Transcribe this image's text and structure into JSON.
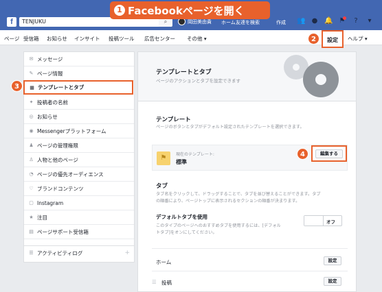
{
  "callout": {
    "number": "1",
    "text": "Facebookページを開く"
  },
  "topbar": {
    "logo": "f",
    "search_value": "TENJUKU",
    "search_icon": "search-icon",
    "user_name": "岡田美由貴",
    "nav": [
      "ホーム",
      "友達を検索",
      "作成"
    ]
  },
  "pagenav": {
    "items": [
      "ページ",
      "受信箱",
      "お知らせ",
      "インサイト",
      "投稿ツール",
      "広告センター",
      "その他 ▾"
    ],
    "settings": "設定",
    "help": "ヘルプ ▾",
    "badge": "2"
  },
  "sidebar": {
    "badge": "3",
    "items": [
      {
        "label": "メッセージ",
        "icon": "message-icon"
      },
      {
        "label": "ページ情報",
        "icon": "pencil-icon"
      },
      {
        "label": "テンプレートとタブ",
        "icon": "grid-icon"
      },
      {
        "label": "投稿者の名前",
        "icon": "tag-icon"
      },
      {
        "label": "お知らせ",
        "icon": "globe-icon"
      },
      {
        "label": "Messengerプラットフォーム",
        "icon": "messenger-icon"
      },
      {
        "label": "ページの管理権限",
        "icon": "person-icon"
      },
      {
        "label": "人物と他のページ",
        "icon": "person-plus-icon"
      },
      {
        "label": "ページの優先オーディエンス",
        "icon": "audience-icon"
      },
      {
        "label": "ブランドコンテンツ",
        "icon": "handshake-icon"
      },
      {
        "label": "Instagram",
        "icon": "instagram-icon"
      },
      {
        "label": "注目",
        "icon": "star-icon"
      },
      {
        "label": "ページサポート受信箱",
        "icon": "inbox-icon"
      }
    ],
    "activity": "アクティビティログ"
  },
  "main": {
    "title": "テンプレートとタブ",
    "subtitle": "ページのアクションとタブを設定できます",
    "template_title": "テンプレート",
    "template_desc": "ページのボタンとタブがデフォルト設定されたテンプレートを選択できます。",
    "current_label": "現在のテンプレート:",
    "current_value": "標準",
    "edit_button": "編集する",
    "edit_badge": "4",
    "tabs_title": "タブ",
    "tabs_desc_1": "タブ名をクリックして、ドラッグすることで、タブを並び替えることができます。タブ",
    "tabs_desc_2": "の順番により、ページトップに表示されるセクションの順番が決まります。",
    "default_tabs_title": "デフォルトタブを使用",
    "default_tabs_desc_1": "このタイプのページへのおすすめタブを使用するには、[デフォル",
    "default_tabs_desc_2": "トタブ]をオンにしてください。",
    "toggle_state": "オフ",
    "rows": [
      {
        "label": "ホーム",
        "button": "設定"
      },
      {
        "label": "投稿",
        "button": "設定"
      }
    ]
  }
}
